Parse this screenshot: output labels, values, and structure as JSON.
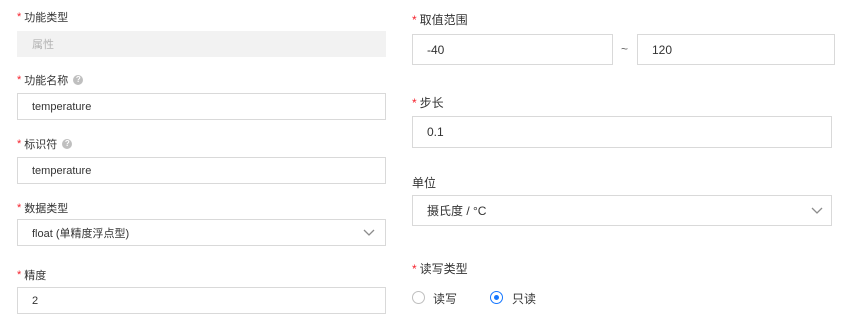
{
  "left": {
    "func_type": {
      "label": "功能类型",
      "value": "属性"
    },
    "func_name": {
      "label": "功能名称",
      "value": "temperature"
    },
    "identifier": {
      "label": "标识符",
      "value": "temperature"
    },
    "data_type": {
      "label": "数据类型",
      "value": "float (单精度浮点型)"
    },
    "precision": {
      "label": "精度",
      "value": "2"
    }
  },
  "right": {
    "range": {
      "label": "取值范围",
      "min": "-40",
      "separator": "~",
      "max": "120"
    },
    "step": {
      "label": "步长",
      "value": "0.1"
    },
    "unit": {
      "label": "单位",
      "value": "摄氏度 / °C"
    },
    "rw_type": {
      "label": "读写类型",
      "options": [
        {
          "label": "读写",
          "checked": false
        },
        {
          "label": "只读",
          "checked": true
        }
      ]
    }
  },
  "colors": {
    "required": "#f5222d",
    "accent": "#1677ff",
    "border": "#d9d9d9",
    "disabled_bg": "#f2f2f2"
  }
}
